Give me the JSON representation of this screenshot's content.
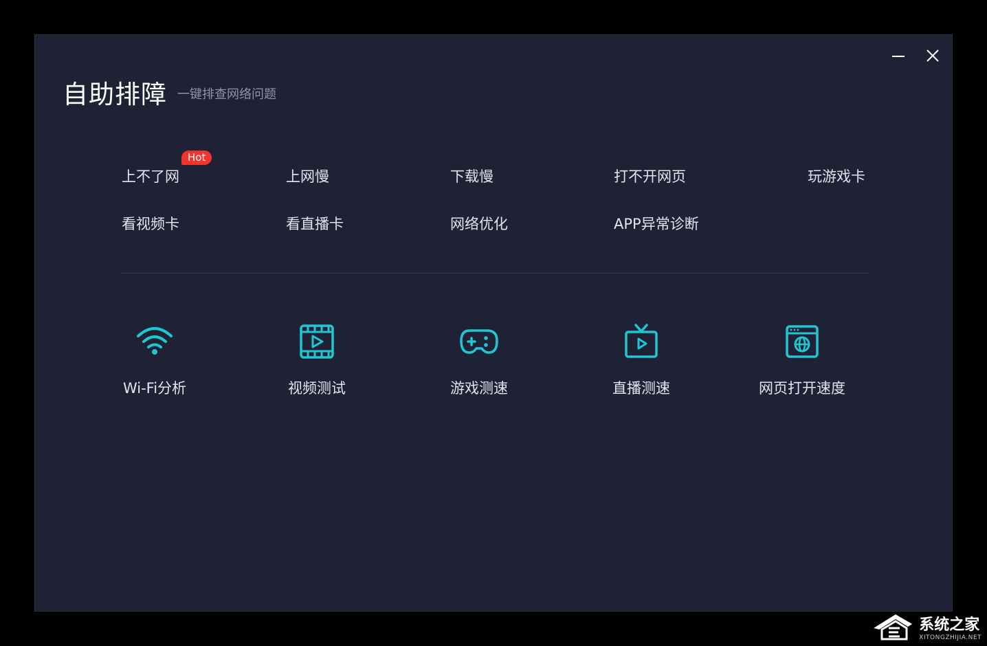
{
  "window": {
    "title": "自助排障",
    "subtitle": "一键排查网络问题"
  },
  "issues": [
    {
      "label": "上不了网"
    },
    {
      "label": "上网慢"
    },
    {
      "label": "下载慢"
    },
    {
      "label": "打不开网页"
    },
    {
      "label": "玩游戏卡"
    },
    {
      "label": "看视频卡"
    },
    {
      "label": "看直播卡"
    },
    {
      "label": "网络优化"
    },
    {
      "label": "APP异常诊断"
    }
  ],
  "hot_badge": "Hot",
  "tools": [
    {
      "label": "Wi-Fi分析",
      "icon": "wifi-icon"
    },
    {
      "label": "视频测试",
      "icon": "video-film-icon"
    },
    {
      "label": "游戏测速",
      "icon": "gamepad-icon"
    },
    {
      "label": "直播测速",
      "icon": "live-tv-icon"
    },
    {
      "label": "网页打开速度",
      "icon": "browser-globe-icon"
    }
  ],
  "colors": {
    "accent": "#1fc7d4",
    "background": "#1f2135",
    "hot": "#f0352f"
  },
  "watermark": {
    "brand": "系统之家",
    "url": "XITONGZHIJIA.NET"
  }
}
